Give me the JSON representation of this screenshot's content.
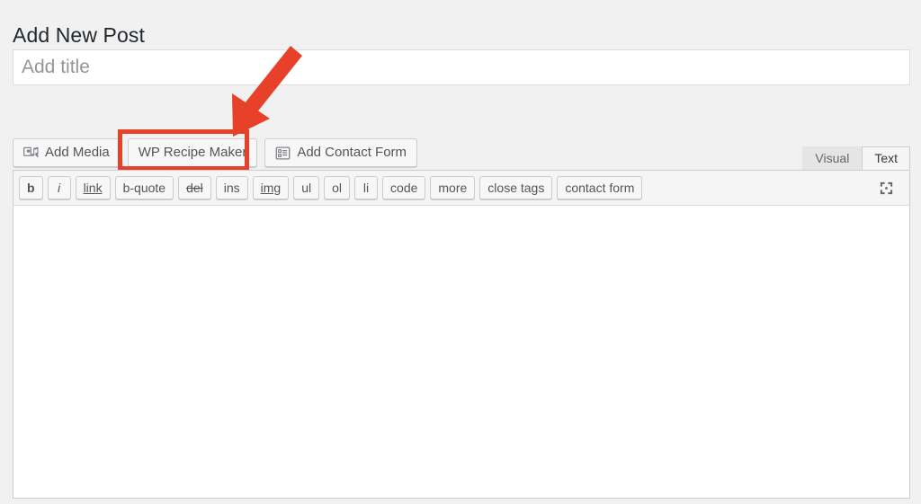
{
  "page": {
    "title": "Add New Post"
  },
  "title_field": {
    "value": "",
    "placeholder": "Add title"
  },
  "media_buttons": [
    {
      "label": "Add Media",
      "icon": "add-media-icon",
      "has_icon": true,
      "highlighted": false
    },
    {
      "label": "WP Recipe Maker",
      "icon": "",
      "has_icon": false,
      "highlighted": true
    },
    {
      "label": "Add Contact Form",
      "icon": "contact-form-icon",
      "has_icon": true,
      "highlighted": false
    }
  ],
  "editor_tabs": [
    {
      "label": "Visual",
      "active": false
    },
    {
      "label": "Text",
      "active": true
    }
  ],
  "quicktags": [
    {
      "label": "b",
      "style": "bold"
    },
    {
      "label": "i",
      "style": "italic"
    },
    {
      "label": "link",
      "style": "underline"
    },
    {
      "label": "b-quote",
      "style": ""
    },
    {
      "label": "del",
      "style": "strike"
    },
    {
      "label": "ins",
      "style": ""
    },
    {
      "label": "img",
      "style": "underline"
    },
    {
      "label": "ul",
      "style": ""
    },
    {
      "label": "ol",
      "style": ""
    },
    {
      "label": "li",
      "style": ""
    },
    {
      "label": "code",
      "style": ""
    },
    {
      "label": "more",
      "style": ""
    },
    {
      "label": "close tags",
      "style": ""
    },
    {
      "label": "contact form",
      "style": ""
    }
  ],
  "toolbar_right": {
    "fullscreen_icon": "distraction-free-writing-icon"
  },
  "content_field": {
    "value": "",
    "placeholder": ""
  },
  "annotation": {
    "arrow_color": "#e8412a",
    "highlight_color": "#e8412a",
    "points_to": "WP Recipe Maker"
  }
}
